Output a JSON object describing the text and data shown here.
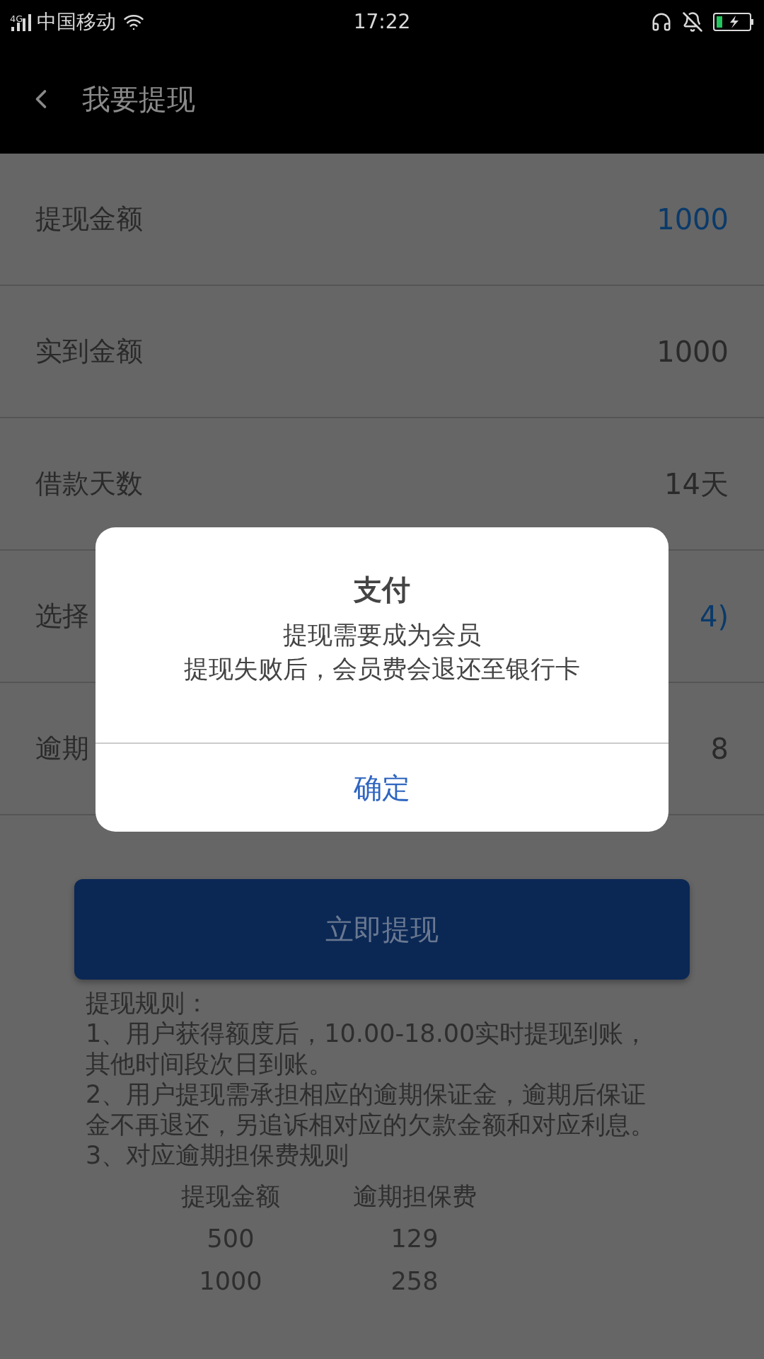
{
  "status_bar": {
    "network": "4G",
    "carrier": "中国移动",
    "time": "17:22"
  },
  "header": {
    "title": "我要提现"
  },
  "rows": [
    {
      "label": "提现金额",
      "value": "1000",
      "kind": "input"
    },
    {
      "label": "实到金额",
      "value": "1000",
      "kind": "text"
    },
    {
      "label": "借款天数",
      "value": "14天",
      "kind": "text"
    },
    {
      "label": "选择",
      "value": "4)",
      "kind": "input"
    },
    {
      "label": "逾期",
      "value": "8",
      "kind": "text"
    }
  ],
  "dialog": {
    "title": "支付",
    "lines": [
      "提现需要成为会员",
      "提现失败后，会员费会退还至银行卡"
    ],
    "button": "确定"
  },
  "submit_button": {
    "label": "立即提现"
  },
  "rules": {
    "title": "提现规则：",
    "paragraphs": [
      "1、用户获得额度后，10.00-18.00实时提现到账，其他时间段次日到账。",
      "2、用户提现需承担相应的逾期保证金，逾期后保证金不再退还，另追诉相对应的欠款金额和对应利息。",
      "3、对应逾期担保费规则"
    ],
    "table": {
      "columns": [
        "提现金额",
        "逾期担保费"
      ],
      "rows": [
        [
          "500",
          "129"
        ],
        [
          "1000",
          "258"
        ]
      ]
    }
  }
}
